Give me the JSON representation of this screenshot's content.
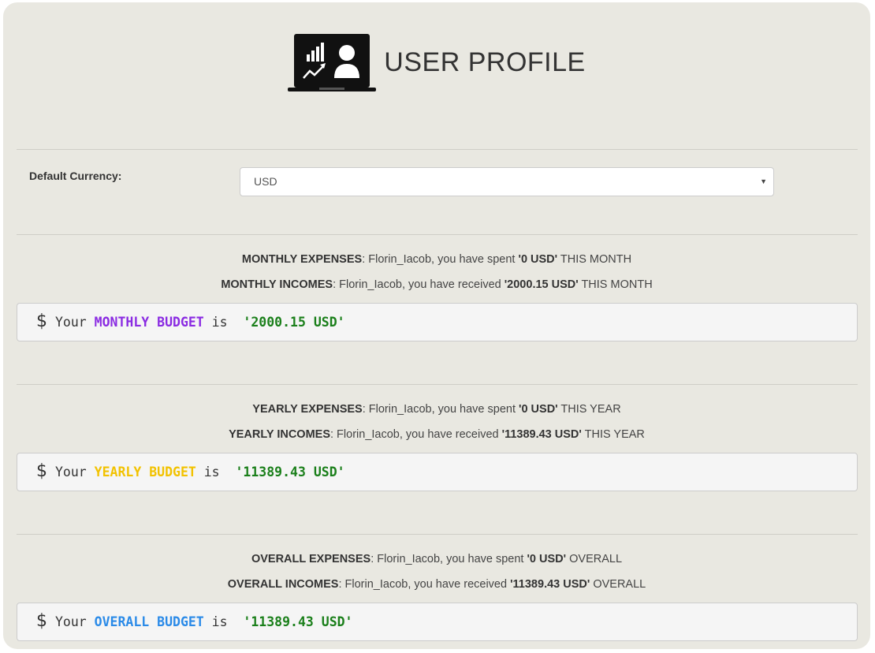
{
  "header": {
    "title": "USER PROFILE",
    "icon": "laptop-profile-analytics-icon"
  },
  "currency": {
    "label": "Default Currency:",
    "selected": "USD"
  },
  "sections": [
    {
      "expenses_label": "MONTHLY EXPENSES",
      "expenses_text": ": Florin_Iacob, you have spent ",
      "expenses_value": "'0 USD'",
      "expenses_suffix": " THIS MONTH",
      "incomes_label": "MONTHLY INCOMES",
      "incomes_text": ": Florin_Iacob, you have received ",
      "incomes_value": "'2000.15 USD'",
      "incomes_suffix": " THIS MONTH",
      "budget_prefix": "Your ",
      "budget_keyword": "MONTHLY BUDGET",
      "budget_is": " is  ",
      "budget_value": "'2000.15 USD'",
      "keyword_color": "#8a2be2"
    },
    {
      "expenses_label": "YEARLY EXPENSES",
      "expenses_text": ": Florin_Iacob, you have spent ",
      "expenses_value": "'0 USD'",
      "expenses_suffix": " THIS YEAR",
      "incomes_label": "YEARLY INCOMES",
      "incomes_text": ": Florin_Iacob, you have received ",
      "incomes_value": "'11389.43 USD'",
      "incomes_suffix": " THIS YEAR",
      "budget_prefix": "Your ",
      "budget_keyword": "YEARLY BUDGET",
      "budget_is": " is  ",
      "budget_value": "'11389.43 USD'",
      "keyword_color": "#f2c200"
    },
    {
      "expenses_label": "OVERALL EXPENSES",
      "expenses_text": ": Florin_Iacob, you have spent ",
      "expenses_value": "'0 USD'",
      "expenses_suffix": " OVERALL",
      "incomes_label": "OVERALL INCOMES",
      "incomes_text": ": Florin_Iacob, you have received ",
      "incomes_value": "'11389.43 USD'",
      "incomes_suffix": " OVERALL",
      "budget_prefix": "Your ",
      "budget_keyword": "OVERALL BUDGET",
      "budget_is": " is  ",
      "budget_value": "'11389.43 USD'",
      "keyword_color": "#2a8ae8"
    }
  ],
  "budget_symbol": "$",
  "value_color": "#1a7f1a"
}
